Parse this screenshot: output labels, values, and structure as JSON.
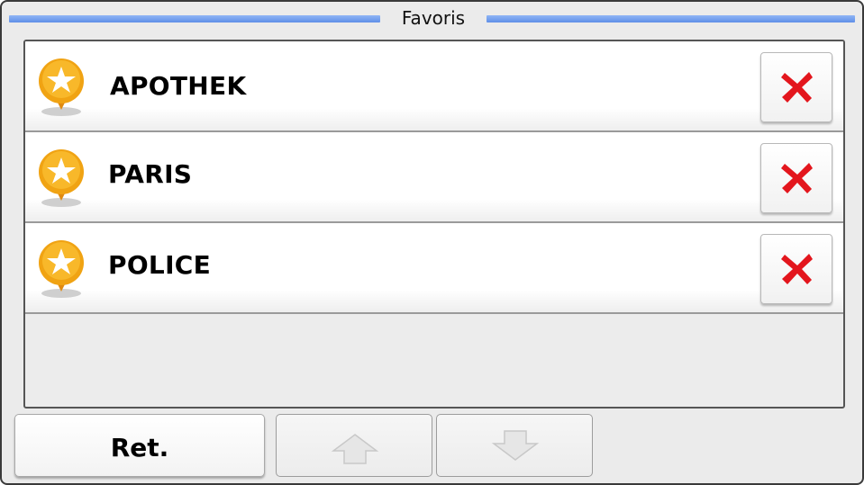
{
  "header": {
    "title": "Favoris"
  },
  "favorites": [
    {
      "label": "APOTHEK",
      "icon": "star-pin-icon",
      "delete_icon": "delete-x-icon"
    },
    {
      "label": "PARIS",
      "icon": "star-pin-icon",
      "delete_icon": "delete-x-icon"
    },
    {
      "label": "POLICE",
      "icon": "star-pin-icon",
      "delete_icon": "delete-x-icon"
    }
  ],
  "footer": {
    "back_label": "Ret.",
    "up_icon": "arrow-up-icon",
    "down_icon": "arrow-down-icon"
  },
  "colors": {
    "title_accent": "#6f9cee",
    "pin_orange": "#f0a313",
    "delete_red": "#e3161d"
  }
}
